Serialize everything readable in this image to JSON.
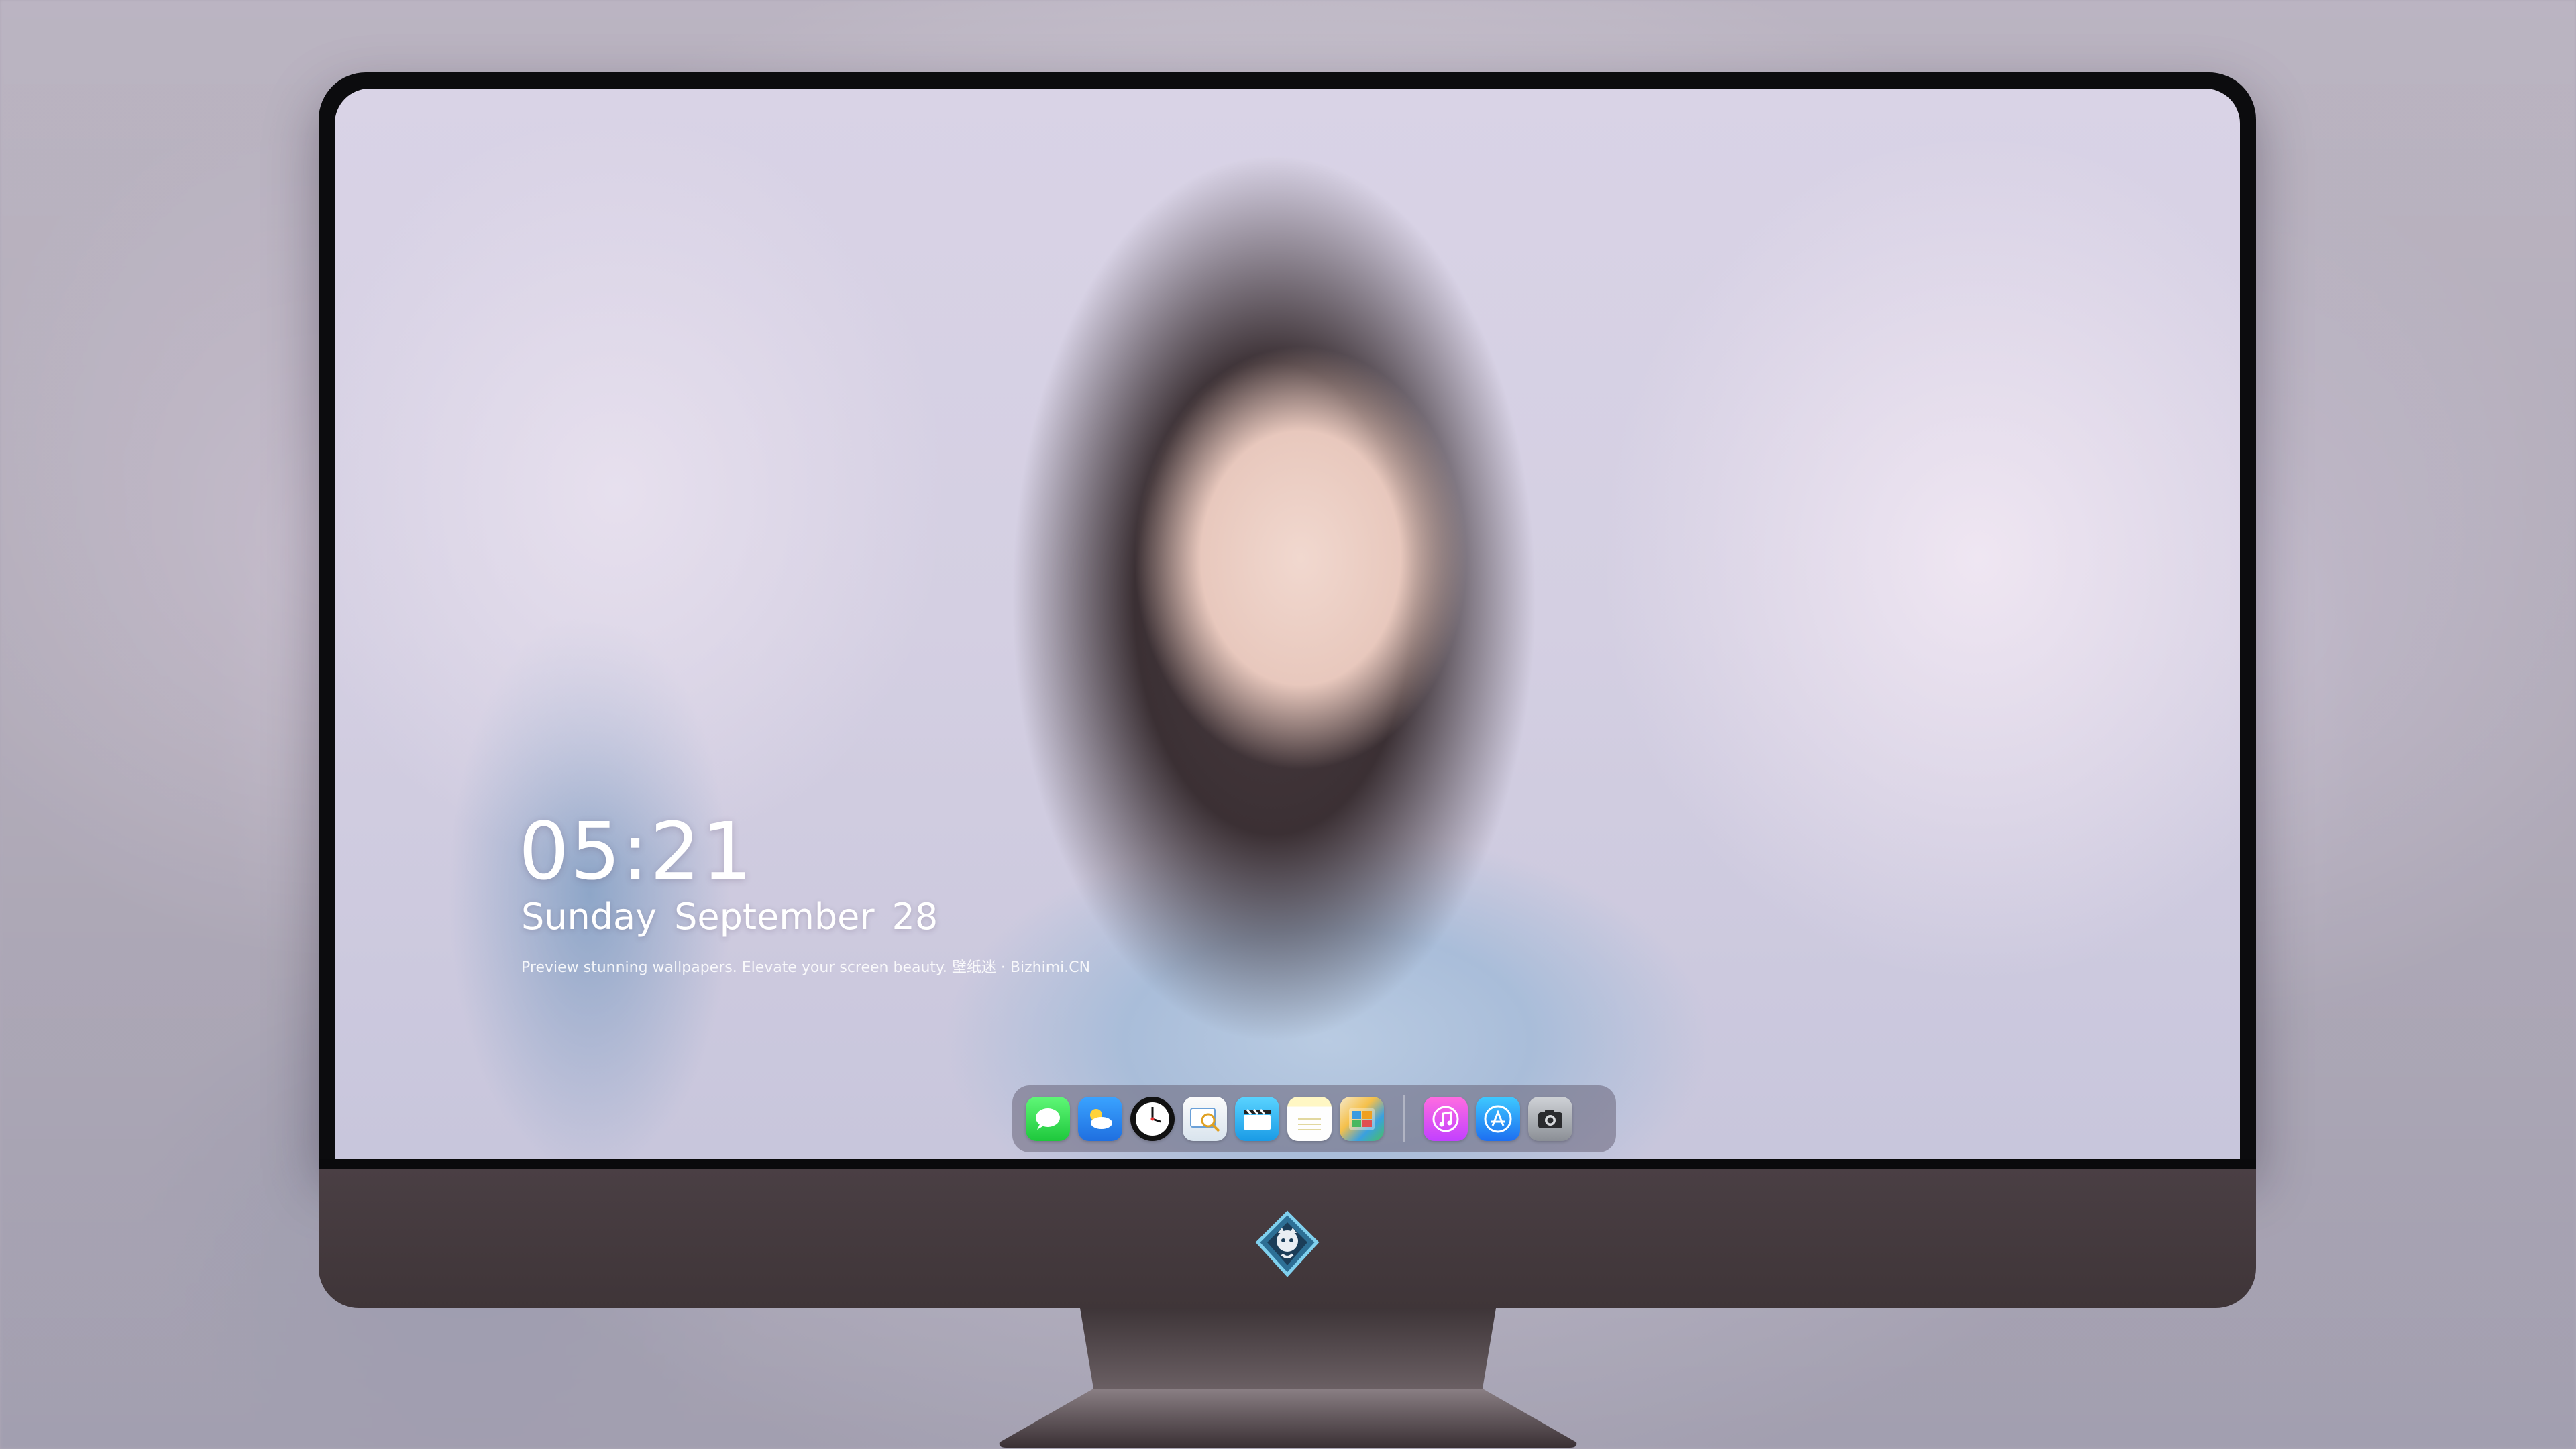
{
  "lock_screen": {
    "time": "05:21",
    "weekday": "Sunday",
    "month": "September",
    "day": "28",
    "tagline": "Preview stunning wallpapers. Elevate your screen beauty. 壁纸迷 · Bizhimi.CN"
  },
  "dock": {
    "apps": [
      {
        "name": "messages-icon"
      },
      {
        "name": "weather-icon"
      },
      {
        "name": "clock-icon"
      },
      {
        "name": "preview-icon"
      },
      {
        "name": "clips-icon"
      },
      {
        "name": "notes-icon"
      },
      {
        "name": "gallery-icon"
      },
      {
        "name": "music-icon"
      },
      {
        "name": "app-store-icon"
      },
      {
        "name": "camera-icon"
      }
    ]
  },
  "colors": {
    "bezel": "#0c0c0e",
    "chin": "#463b40",
    "dock_bg": "rgba(105,100,120,0.55)"
  }
}
